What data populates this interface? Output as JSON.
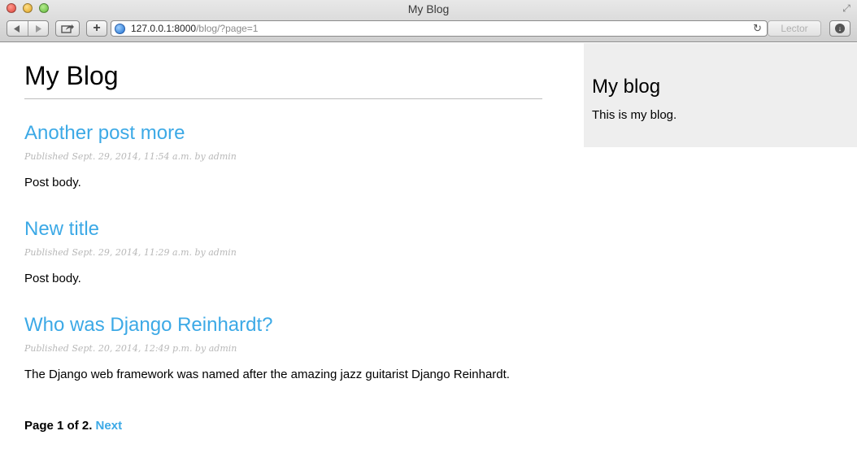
{
  "window": {
    "title": "My Blog"
  },
  "toolbar": {
    "url_host": "127.0.0.1:8000",
    "url_path": "/blog/?page=1",
    "reader_label": "Lector",
    "add_label": "+"
  },
  "page": {
    "title": "My Blog",
    "posts": [
      {
        "title": "Another post more",
        "meta": "Published Sept. 29, 2014, 11:54 a.m. by admin",
        "body": "Post body."
      },
      {
        "title": "New title",
        "meta": "Published Sept. 29, 2014, 11:29 a.m. by admin",
        "body": "Post body."
      },
      {
        "title": "Who was Django Reinhardt?",
        "meta": "Published Sept. 20, 2014, 12:49 p.m. by admin",
        "body": "The Django web framework was named after the amazing jazz guitarist Django Reinhardt."
      }
    ],
    "pagination": {
      "status": "Page 1 of 2.",
      "next_label": "Next"
    }
  },
  "sidebar": {
    "title": "My blog",
    "text": "This is my blog."
  },
  "colors": {
    "link": "#3ca9e6",
    "sidebar_bg": "#eeeeee",
    "meta": "#b8b8b8"
  }
}
